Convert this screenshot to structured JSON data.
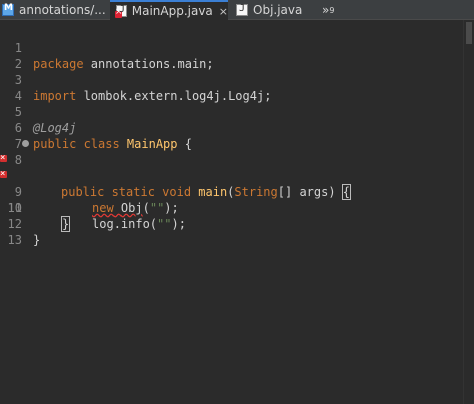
{
  "tabs": [
    {
      "label": "annotations/...",
      "icon": "maven-icon"
    },
    {
      "label": "MainApp.java",
      "icon": "java-file-error-icon",
      "active": true,
      "close": "×"
    },
    {
      "label": "Obj.java",
      "icon": "java-file-icon"
    }
  ],
  "overflow": {
    "label": "»",
    "count": "9"
  },
  "lines": [
    {
      "n": "1"
    },
    {
      "n": "2"
    },
    {
      "n": "3"
    },
    {
      "n": "4"
    },
    {
      "n": "5"
    },
    {
      "n": "6"
    },
    {
      "n": "7"
    },
    {
      "n": "8"
    },
    {
      "n": "9"
    },
    {
      "n": "10"
    },
    {
      "n": "11"
    },
    {
      "n": "12"
    },
    {
      "n": "13"
    }
  ],
  "code": {
    "l1_kw": "package",
    "l1_rest": " annotations.main;",
    "l3_kw": "import",
    "l3_rest": " lombok.extern.log4j.Log4j;",
    "l5": "@Log4j",
    "l6_kw": "public class",
    "l6_name": " MainApp",
    "l6_rest": " {",
    "l8_kw": "public static void",
    "l8_method": " main",
    "l8_p1": "(",
    "l8_type": "String",
    "l8_p2": "[] args) ",
    "l8_brace": "{",
    "l9_kw": "new",
    "l9_sp": " ",
    "l9_err": "Obj",
    "l9_p": "(",
    "l9_str": "\"\"",
    "l9_end": ");",
    "l10_obj": "log",
    "l10_call": ".info(",
    "l10_str": "\"\"",
    "l10_end": ");",
    "l11": "}",
    "l12": "}"
  },
  "colors": {
    "keyword": "#cc7832",
    "string": "#6a8759",
    "error": "#d32f2f"
  }
}
